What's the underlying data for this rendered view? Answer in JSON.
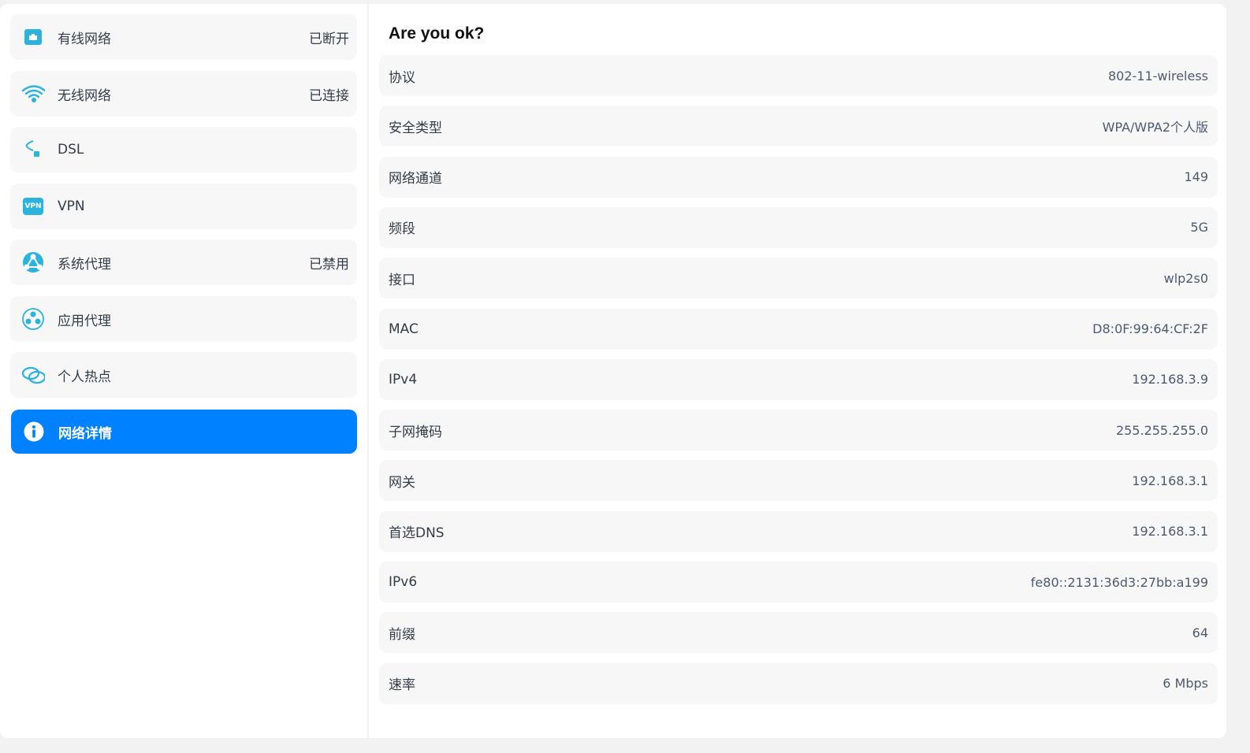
{
  "sidebar": {
    "items": [
      {
        "label": "有线网络",
        "status": "已断开",
        "icon": "wired-network-icon"
      },
      {
        "label": "无线网络",
        "status": "已连接",
        "icon": "wifi-icon"
      },
      {
        "label": "DSL",
        "status": "",
        "icon": "dsl-cable-icon"
      },
      {
        "label": "VPN",
        "status": "",
        "icon": "vpn-icon",
        "icon_text": "VPN"
      },
      {
        "label": "系统代理",
        "status": "已禁用",
        "icon": "system-proxy-icon"
      },
      {
        "label": "应用代理",
        "status": "",
        "icon": "app-proxy-icon"
      },
      {
        "label": "个人热点",
        "status": "",
        "icon": "hotspot-icon"
      },
      {
        "label": "网络详情",
        "status": "",
        "icon": "info-icon",
        "active": true
      }
    ]
  },
  "details": {
    "title": "Are you ok?",
    "rows": [
      {
        "key": "协议",
        "value": "802-11-wireless"
      },
      {
        "key": "安全类型",
        "value": "WPA/WPA2个人版"
      },
      {
        "key": "网络通道",
        "value": "149"
      },
      {
        "key": "频段",
        "value": "5G"
      },
      {
        "key": "接口",
        "value": "wlp2s0"
      },
      {
        "key": "MAC",
        "value": "D8:0F:99:64:CF:2F"
      },
      {
        "key": "IPv4",
        "value": "192.168.3.9"
      },
      {
        "key": "子网掩码",
        "value": "255.255.255.0"
      },
      {
        "key": "网关",
        "value": "192.168.3.1"
      },
      {
        "key": "首选DNS",
        "value": "192.168.3.1"
      },
      {
        "key": "IPv6",
        "value": "fe80::2131:36d3:27bb:a199"
      },
      {
        "key": "前缀",
        "value": "64"
      },
      {
        "key": "速率",
        "value": "6 Mbps"
      }
    ]
  },
  "colors": {
    "accent": "#0081ff",
    "icon": "#2bb3e0"
  }
}
